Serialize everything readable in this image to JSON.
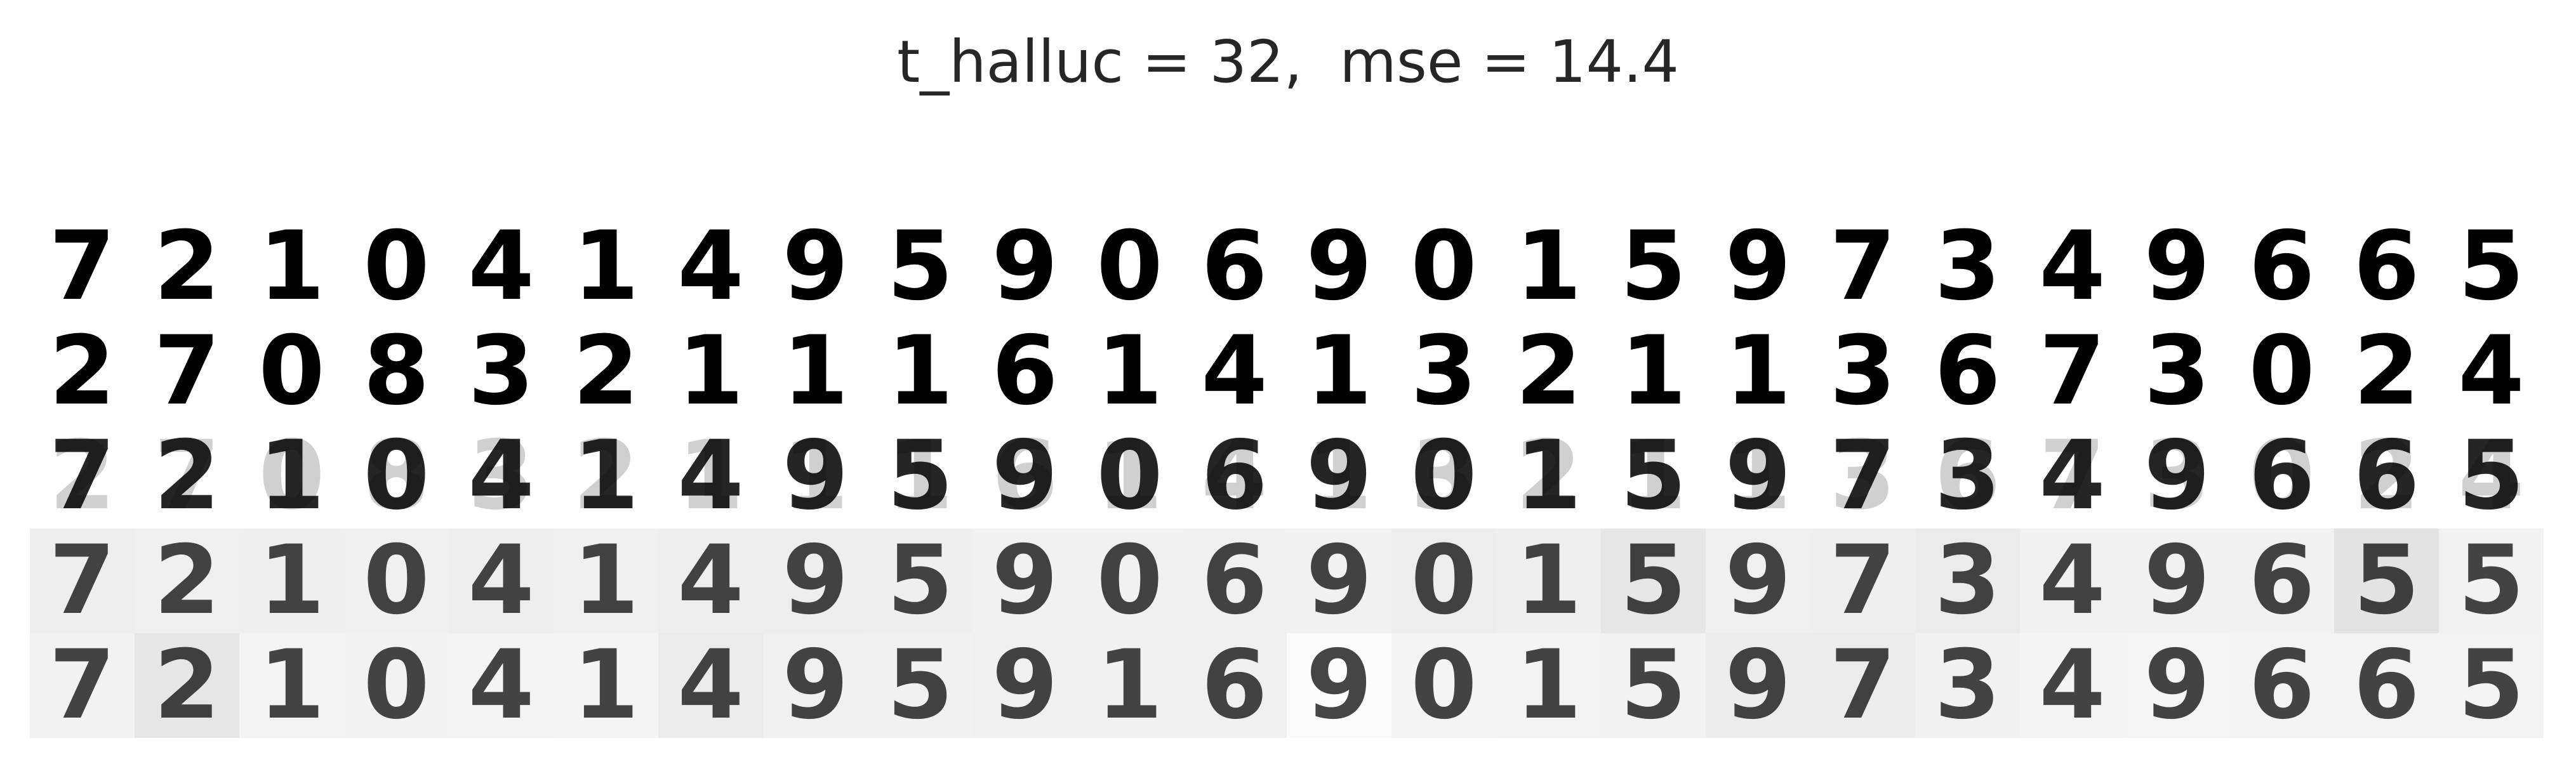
{
  "title": "t_halluc = 32,  mse = 14.4",
  "rows": [
    {
      "name": "target-row",
      "digits": [
        "7",
        "2",
        "1",
        "0",
        "4",
        "1",
        "4",
        "9",
        "5",
        "9",
        "0",
        "6",
        "9",
        "0",
        "1",
        "5",
        "9",
        "7",
        "3",
        "4",
        "9",
        "6",
        "6",
        "5"
      ],
      "ink": 1.0,
      "backgrounds": [
        "#ffffff",
        "#ffffff",
        "#ffffff",
        "#ffffff",
        "#ffffff",
        "#ffffff",
        "#ffffff",
        "#ffffff",
        "#ffffff",
        "#ffffff",
        "#ffffff",
        "#ffffff",
        "#ffffff",
        "#ffffff",
        "#ffffff",
        "#ffffff",
        "#ffffff",
        "#ffffff",
        "#ffffff",
        "#ffffff",
        "#ffffff",
        "#ffffff",
        "#ffffff",
        "#ffffff"
      ]
    },
    {
      "name": "distractor-row",
      "digits": [
        "2",
        "7",
        "0",
        "8",
        "3",
        "2",
        "1",
        "1",
        "1",
        "6",
        "1",
        "4",
        "1",
        "3",
        "2",
        "1",
        "1",
        "3",
        "6",
        "7",
        "3",
        "0",
        "2",
        "4"
      ],
      "ink": 1.0,
      "backgrounds": [
        "#ffffff",
        "#ffffff",
        "#ffffff",
        "#ffffff",
        "#ffffff",
        "#ffffff",
        "#ffffff",
        "#ffffff",
        "#ffffff",
        "#ffffff",
        "#ffffff",
        "#ffffff",
        "#ffffff",
        "#ffffff",
        "#ffffff",
        "#ffffff",
        "#ffffff",
        "#ffffff",
        "#ffffff",
        "#ffffff",
        "#ffffff",
        "#ffffff",
        "#ffffff",
        "#ffffff"
      ]
    },
    {
      "name": "superposition-row",
      "digits": [
        "7",
        "2",
        "1",
        "0",
        "4",
        "1",
        "4",
        "9",
        "5",
        "9",
        "0",
        "6",
        "9",
        "0",
        "1",
        "5",
        "9",
        "7",
        "3",
        "4",
        "9",
        "6",
        "6",
        "5"
      ],
      "ghosts": [
        "2",
        "7",
        "0",
        "8",
        "3",
        "2",
        "1",
        "1",
        "1",
        "6",
        "1",
        "4",
        "1",
        "3",
        "2",
        "1",
        "1",
        "3",
        "6",
        "7",
        "3",
        "0",
        "2",
        "4"
      ],
      "ink": 0.85,
      "backgrounds": [
        "#ffffff",
        "#ffffff",
        "#ffffff",
        "#ffffff",
        "#ffffff",
        "#ffffff",
        "#ffffff",
        "#ffffff",
        "#ffffff",
        "#ffffff",
        "#ffffff",
        "#ffffff",
        "#ffffff",
        "#ffffff",
        "#ffffff",
        "#ffffff",
        "#ffffff",
        "#ffffff",
        "#ffffff",
        "#ffffff",
        "#ffffff",
        "#ffffff",
        "#ffffff",
        "#ffffff"
      ]
    },
    {
      "name": "reconstruction-row-a",
      "digits": [
        "7",
        "2",
        "1",
        "0",
        "4",
        "1",
        "4",
        "9",
        "5",
        "9",
        "0",
        "6",
        "9",
        "0",
        "1",
        "5",
        "9",
        "7",
        "3",
        "4",
        "9",
        "6",
        "5",
        "5"
      ],
      "ink": 0.72,
      "backgrounds": [
        "#eeeeee",
        "#f0f0f0",
        "#efefef",
        "#f0f0f0",
        "#eeeeee",
        "#f0f0f0",
        "#eeeeee",
        "#eeeeee",
        "#efefef",
        "#f1f1f1",
        "#f1f1f1",
        "#f0f0f0",
        "#f1f1f1",
        "#ededed",
        "#efefef",
        "#e6e6e6",
        "#f0f0f0",
        "#efefef",
        "#ebebeb",
        "#f1f1f1",
        "#f1f1f1",
        "#f1f1f1",
        "#e3e3e3",
        "#f2f2f2"
      ]
    },
    {
      "name": "reconstruction-row-b",
      "digits": [
        "7",
        "2",
        "1",
        "0",
        "4",
        "1",
        "4",
        "9",
        "5",
        "9",
        "1",
        "6",
        "9",
        "0",
        "1",
        "5",
        "9",
        "7",
        "3",
        "4",
        "9",
        "6",
        "6",
        "5"
      ],
      "ink": 0.72,
      "backgrounds": [
        "#f2f2f2",
        "#e6e6e6",
        "#f3f3f3",
        "#f2f2f2",
        "#f3f3f3",
        "#f4f4f4",
        "#ebebeb",
        "#f0f0f0",
        "#f1f1f1",
        "#f0f0f0",
        "#f1f1f1",
        "#f0f0f0",
        "#fbfbfb",
        "#f4f4f4",
        "#f3f3f3",
        "#f2f2f2",
        "#ececec",
        "#ececec",
        "#f1f1f1",
        "#f4f4f4",
        "#f5f5f5",
        "#f3f3f3",
        "#f3f3f3",
        "#f3f3f3"
      ]
    }
  ]
}
